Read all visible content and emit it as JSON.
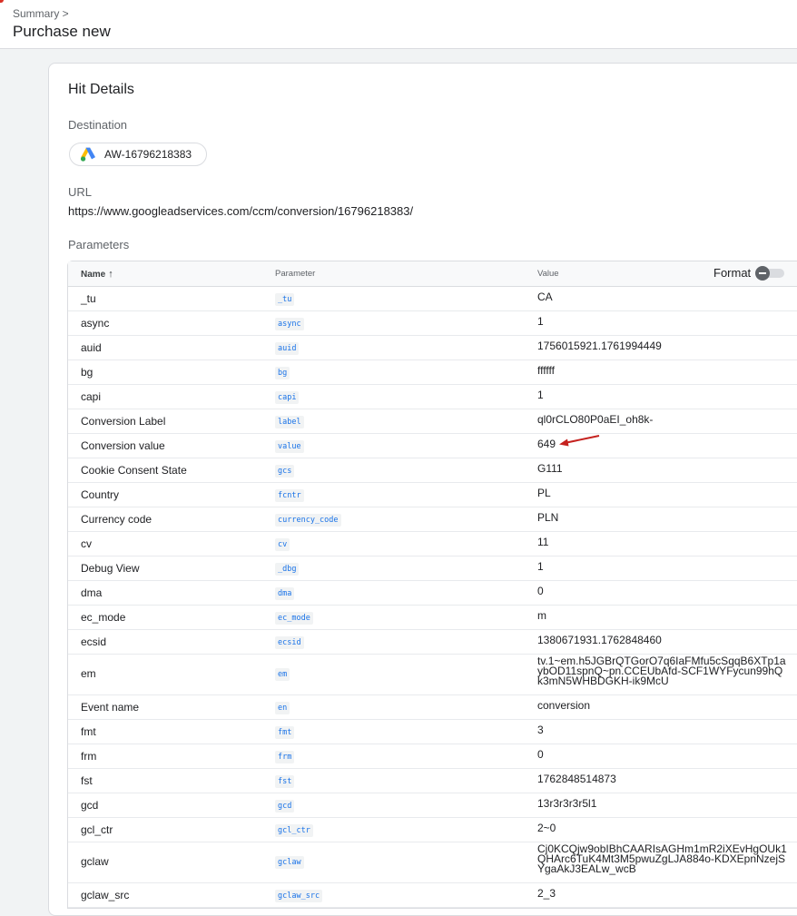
{
  "breadcrumb": "Summary >",
  "page_title": "Purchase new",
  "card_title": "Hit Details",
  "destination": {
    "label": "Destination",
    "id": "AW-16796218383"
  },
  "url_section": {
    "label": "URL",
    "value": "https://www.googleadservices.com/ccm/conversion/16796218383/"
  },
  "parameters_label": "Parameters",
  "table": {
    "headers": {
      "name": "Name",
      "parameter": "Parameter",
      "value": "Value"
    },
    "format_label": "Format",
    "rows": [
      {
        "name": "_tu",
        "param": "_tu",
        "value": "CA"
      },
      {
        "name": "async",
        "param": "async",
        "value": "1"
      },
      {
        "name": "auid",
        "param": "auid",
        "value": "1756015921.1761994449"
      },
      {
        "name": "bg",
        "param": "bg",
        "value": "ffffff"
      },
      {
        "name": "capi",
        "param": "capi",
        "value": "1"
      },
      {
        "name": "Conversion Label",
        "param": "label",
        "value": "ql0rCLO80P0aEI_oh8k-"
      },
      {
        "name": "Conversion value",
        "param": "value",
        "value": "649"
      },
      {
        "name": "Cookie Consent State",
        "param": "gcs",
        "value": "G111"
      },
      {
        "name": "Country",
        "param": "fcntr",
        "value": "PL"
      },
      {
        "name": "Currency code",
        "param": "currency_code",
        "value": "PLN"
      },
      {
        "name": "cv",
        "param": "cv",
        "value": "11"
      },
      {
        "name": "Debug View",
        "param": "_dbg",
        "value": "1"
      },
      {
        "name": "dma",
        "param": "dma",
        "value": "0"
      },
      {
        "name": "ec_mode",
        "param": "ec_mode",
        "value": "m"
      },
      {
        "name": "ecsid",
        "param": "ecsid",
        "value": "1380671931.1762848460"
      },
      {
        "name": "em",
        "param": "em",
        "value": "tv.1~em.h5JGBrQTGorO7q6IaFMfu5cSqqB6XTp1aybOD11spnQ~pn.CCEUbAfd-SCF1WYFycun99hQk3mN5WHBDGKH-ik9McU"
      },
      {
        "name": "Event name",
        "param": "en",
        "value": "conversion"
      },
      {
        "name": "fmt",
        "param": "fmt",
        "value": "3"
      },
      {
        "name": "frm",
        "param": "frm",
        "value": "0"
      },
      {
        "name": "fst",
        "param": "fst",
        "value": "1762848514873"
      },
      {
        "name": "gcd",
        "param": "gcd",
        "value": "13r3r3r3r5l1"
      },
      {
        "name": "gcl_ctr",
        "param": "gcl_ctr",
        "value": "2~0"
      },
      {
        "name": "gclaw",
        "param": "gclaw",
        "value": "Cj0KCQjw9obIBhCAARIsAGHm1mR2iXEvHgOUk1QHArc6TuK4Mt3M5pwuZgLJA884o-KDXEpnNzejSYgaAkJ3EALw_wcB"
      },
      {
        "name": "gclaw_src",
        "param": "gclaw_src",
        "value": "2_3"
      }
    ]
  },
  "colors": {
    "accent": "#1a73e8",
    "annotation_arrow": "#c5221f"
  },
  "icons": {
    "destination_logo": "google-ads-logo-icon",
    "sort": "arrow-up-icon",
    "format_toggle": "toggle-off-icon",
    "annotation": "red-arrow-annotation"
  }
}
